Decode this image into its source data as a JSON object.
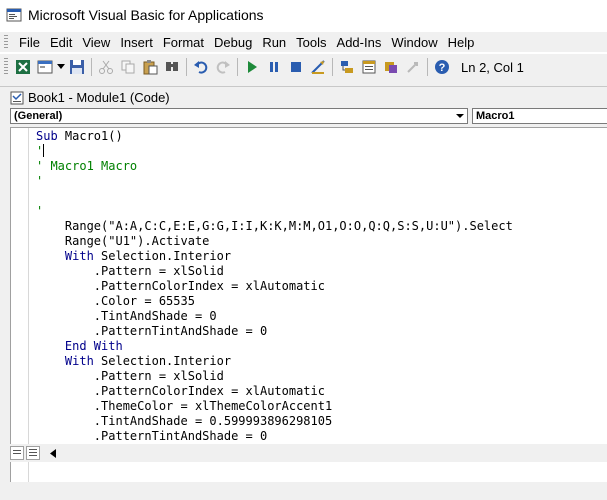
{
  "window": {
    "title": "Microsoft Visual Basic for Applications"
  },
  "menu": {
    "items": [
      {
        "label": "File"
      },
      {
        "label": "Edit"
      },
      {
        "label": "View"
      },
      {
        "label": "Insert"
      },
      {
        "label": "Format"
      },
      {
        "label": "Debug"
      },
      {
        "label": "Run"
      },
      {
        "label": "Tools"
      },
      {
        "label": "Add-Ins"
      },
      {
        "label": "Window"
      },
      {
        "label": "Help"
      }
    ]
  },
  "toolbar": {
    "status": "Ln 2, Col 1",
    "icons": [
      "excel-view-icon",
      "insert-userform-icon",
      "save-icon",
      "cut-icon",
      "copy-icon",
      "paste-icon",
      "find-icon",
      "undo-icon",
      "redo-icon",
      "run-icon",
      "break-icon",
      "reset-icon",
      "design-mode-icon",
      "project-explorer-icon",
      "properties-window-icon",
      "object-browser-icon",
      "toolbox-icon",
      "help-icon"
    ]
  },
  "code_window": {
    "title": "Book1 - Module1 (Code)",
    "object_combo": "(General)",
    "procedure_combo": "Macro1"
  },
  "code": {
    "lines": [
      {
        "parts": [
          {
            "t": "Sub",
            "c": "kw"
          },
          {
            "t": " Macro1()",
            "c": ""
          }
        ]
      },
      {
        "parts": [
          {
            "t": "'",
            "c": "cm"
          }
        ],
        "cursor": true
      },
      {
        "parts": [
          {
            "t": "' Macro1 Macro",
            "c": "cm"
          }
        ]
      },
      {
        "parts": [
          {
            "t": "'",
            "c": "cm"
          }
        ]
      },
      {
        "parts": []
      },
      {
        "parts": [
          {
            "t": "'",
            "c": "cm"
          }
        ]
      },
      {
        "parts": [
          {
            "t": "    Range(\"A:A,C:C,E:E,G:G,I:I,K:K,M:M,O1,O:O,Q:Q,S:S,U:U\").Select",
            "c": ""
          }
        ]
      },
      {
        "parts": [
          {
            "t": "    Range(\"U1\").Activate",
            "c": ""
          }
        ]
      },
      {
        "parts": [
          {
            "t": "    ",
            "c": ""
          },
          {
            "t": "With",
            "c": "kw"
          },
          {
            "t": " Selection.Interior",
            "c": ""
          }
        ]
      },
      {
        "parts": [
          {
            "t": "        .Pattern = xlSolid",
            "c": ""
          }
        ]
      },
      {
        "parts": [
          {
            "t": "        .PatternColorIndex = xlAutomatic",
            "c": ""
          }
        ]
      },
      {
        "parts": [
          {
            "t": "        .Color = 65535",
            "c": ""
          }
        ]
      },
      {
        "parts": [
          {
            "t": "        .TintAndShade = 0",
            "c": ""
          }
        ]
      },
      {
        "parts": [
          {
            "t": "        .PatternTintAndShade = 0",
            "c": ""
          }
        ]
      },
      {
        "parts": [
          {
            "t": "    ",
            "c": ""
          },
          {
            "t": "End With",
            "c": "kw"
          }
        ]
      },
      {
        "parts": [
          {
            "t": "    ",
            "c": ""
          },
          {
            "t": "With",
            "c": "kw"
          },
          {
            "t": " Selection.Interior",
            "c": ""
          }
        ]
      },
      {
        "parts": [
          {
            "t": "        .Pattern = xlSolid",
            "c": ""
          }
        ]
      },
      {
        "parts": [
          {
            "t": "        .PatternColorIndex = xlAutomatic",
            "c": ""
          }
        ]
      },
      {
        "parts": [
          {
            "t": "        .ThemeColor = xlThemeColorAccent1",
            "c": ""
          }
        ]
      },
      {
        "parts": [
          {
            "t": "        .TintAndShade = 0.599993896298105",
            "c": ""
          }
        ]
      },
      {
        "parts": [
          {
            "t": "        .PatternTintAndShade = 0",
            "c": ""
          }
        ]
      }
    ]
  },
  "colors": {
    "keyword": "#00008b",
    "comment": "#008000",
    "chrome": "#f0f0f0"
  }
}
